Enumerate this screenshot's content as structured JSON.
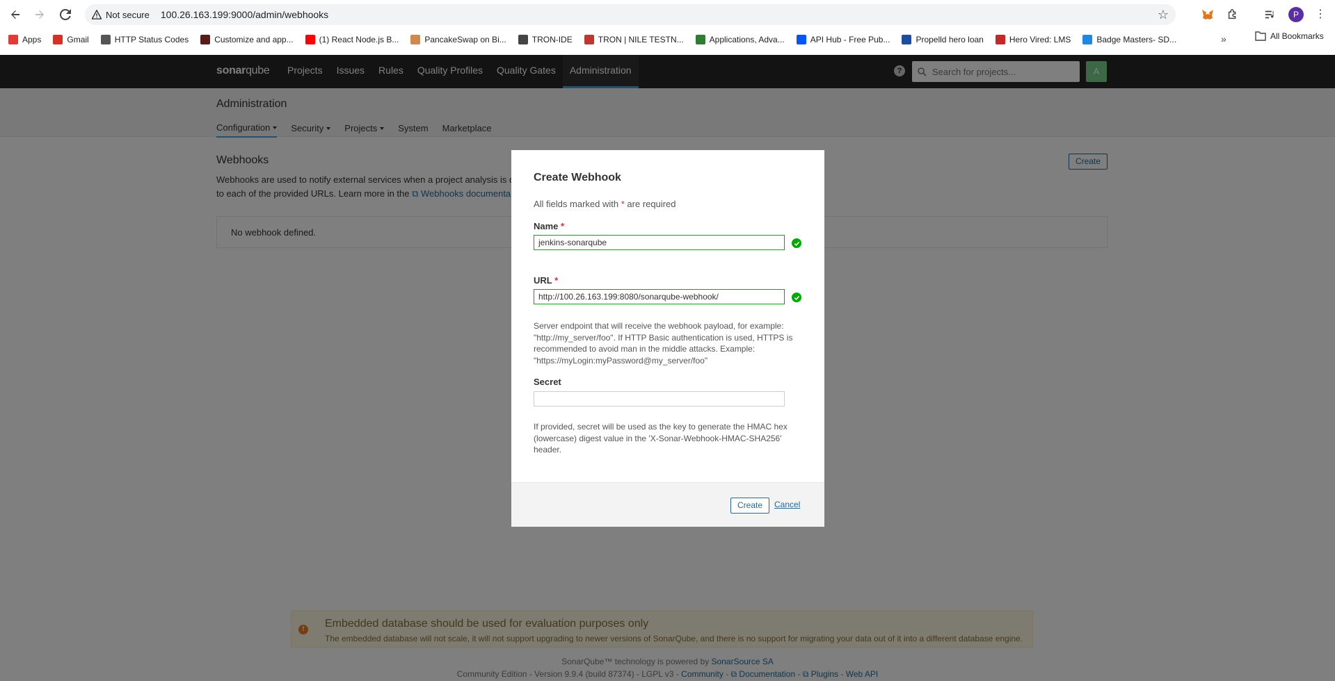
{
  "browser": {
    "security_label": "Not secure",
    "url": "100.26.163.199:9000/admin/webhooks",
    "profile_initial": "P",
    "bookmarks": [
      {
        "label": "Apps",
        "icon": "apps-grid-icon",
        "color": "#e53935"
      },
      {
        "label": "Gmail",
        "icon": "gmail-icon",
        "color": "#d93025"
      },
      {
        "label": "HTTP Status Codes",
        "icon": "globe-icon",
        "color": "#555555"
      },
      {
        "label": "Customize and app...",
        "icon": "crown-icon",
        "color": "#5b1a1a"
      },
      {
        "label": "(1) React Node.js B...",
        "icon": "youtube-icon",
        "color": "#ff0000"
      },
      {
        "label": "PancakeSwap on Bi...",
        "icon": "pancake-icon",
        "color": "#d1884f"
      },
      {
        "label": "TRON-IDE",
        "icon": "tron-ide-icon",
        "color": "#444444"
      },
      {
        "label": "TRON | NILE TESTN...",
        "icon": "tron-icon",
        "color": "#c23631"
      },
      {
        "label": "Applications, Adva...",
        "icon": "infinity-icon",
        "color": "#2e7d32"
      },
      {
        "label": "API Hub - Free Pub...",
        "icon": "rapidapi-icon",
        "color": "#0055ff"
      },
      {
        "label": "Propelld hero loan",
        "icon": "propelld-icon",
        "color": "#1a4fa0"
      },
      {
        "label": "Hero Vired: LMS",
        "icon": "herovired-icon",
        "color": "#c62828"
      },
      {
        "label": "Badge Masters- SD...",
        "icon": "badge-icon",
        "color": "#1e88e5"
      }
    ],
    "all_bookmarks": "All Bookmarks"
  },
  "nav": {
    "logo_bold": "sonar",
    "logo_light": "qube",
    "items": [
      "Projects",
      "Issues",
      "Rules",
      "Quality Profiles",
      "Quality Gates",
      "Administration"
    ],
    "search_placeholder": "Search for projects...",
    "avatar_initial": "A"
  },
  "admin": {
    "title": "Administration",
    "tabs": [
      "Configuration",
      "Security",
      "Projects",
      "System",
      "Marketplace"
    ]
  },
  "webhooks": {
    "title": "Webhooks",
    "desc_line1": "Webhooks are used to notify external services when a project analysis is d",
    "desc_line2_prefix": "to each of the provided URLs. Learn more in the",
    "desc_link": "Webhooks documenta",
    "create_label": "Create",
    "empty_text": "No webhook defined."
  },
  "modal": {
    "title": "Create Webhook",
    "required_prefix": "All fields marked with",
    "required_star": "*",
    "required_suffix": "are required",
    "name_label": "Name",
    "name_value": "jenkins-sonarqube",
    "url_label": "URL",
    "url_value": "http://100.26.163.199:8080/sonarqube-webhook/",
    "url_help": "Server endpoint that will receive the webhook payload, for example: \"http://my_server/foo\". If HTTP Basic authentication is used, HTTPS is recommended to avoid man in the middle attacks. Example: \"https://myLogin:myPassword@my_server/foo\"",
    "secret_label": "Secret",
    "secret_value": "",
    "secret_help": "If provided, secret will be used as the key to generate the HMAC hex (lowercase) digest value in the 'X-Sonar-Webhook-HMAC-SHA256' header.",
    "create_label": "Create",
    "cancel_label": "Cancel"
  },
  "footer": {
    "warn_title": "Embedded database should be used for evaluation purposes only",
    "warn_text": "The embedded database will not scale, it will not support upgrading to newer versions of SonarQube, and there is no support for migrating your data out of it into a different database engine.",
    "line1_prefix": "SonarQube™ technology is powered by",
    "line1_link": "SonarSource SA",
    "line2_text": "Community Edition - Version 9.9.4 (build 87374) - LGPL v3 -",
    "line2_community": "Community",
    "line2_docs": "Documentation",
    "line2_plugins": "Plugins",
    "line2_api": "Web API"
  }
}
